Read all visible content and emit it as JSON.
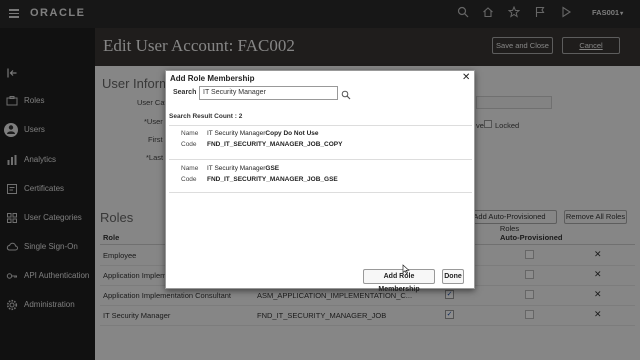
{
  "topbar": {
    "brand": "ORACLE",
    "user": "FAS001"
  },
  "header": {
    "title": "Edit User Account: FAC002",
    "save_close": "Save and Close",
    "cancel": "Cancel"
  },
  "nav": {
    "items": [
      {
        "label": "Roles"
      },
      {
        "label": "Users"
      },
      {
        "label": "Analytics"
      },
      {
        "label": "Certificates"
      },
      {
        "label": "User Categories"
      },
      {
        "label": "Single Sign-On"
      },
      {
        "label": "API Authentication"
      },
      {
        "label": "Administration"
      }
    ]
  },
  "user_info": {
    "title": "User Inform",
    "fields": [
      "User Cat",
      "*User",
      "First",
      "*Last"
    ],
    "locked_label": "Locked",
    "active_label": "ve"
  },
  "roles": {
    "title": "Roles",
    "col_role": "Role",
    "col_auto": "Auto-Provisioned",
    "add_auto": "Add Auto-Provisioned Roles",
    "remove_all": "Remove All Roles",
    "rows": [
      {
        "name": "Employee",
        "code": "",
        "checked": false
      },
      {
        "name": "Application Impleme",
        "code": "",
        "checked": false
      },
      {
        "name": "Application Implementation Consultant",
        "code": "ASM_APPLICATION_IMPLEMENTATION_C...",
        "checked": true
      },
      {
        "name": "IT Security Manager",
        "code": "FND_IT_SECURITY_MANAGER_JOB",
        "checked": true
      }
    ]
  },
  "dialog": {
    "title": "Add Role Membership",
    "search_label": "Search",
    "search_value": "IT Security Manager",
    "result_count": "Search Result Count : 2",
    "name_label": "Name",
    "code_label": "Code",
    "results": [
      {
        "name_prefix": "IT Security Manager",
        "name_suffix": "Copy Do Not Use",
        "code": "FND_IT_SECURITY_MANAGER_JOB_COPY"
      },
      {
        "name_prefix": "IT Security Manager",
        "name_suffix": "GSE",
        "code": "FND_IT_SECURITY_MANAGER_JOB_GSE"
      }
    ],
    "add_button": "Add Role Membership",
    "done_button": "Done"
  }
}
